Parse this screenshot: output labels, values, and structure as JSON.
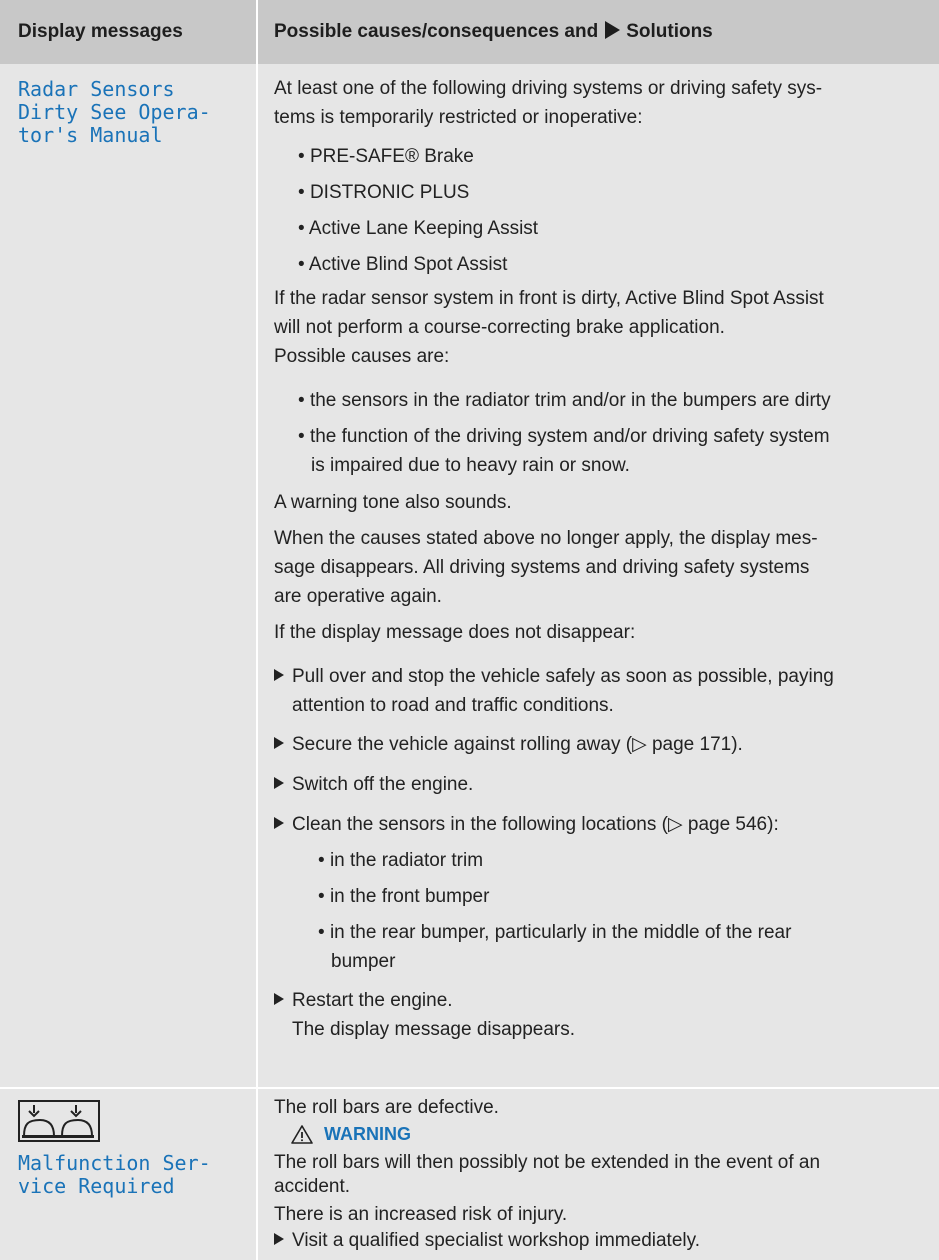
{
  "header": {
    "col1": "Display messages",
    "col2_a": "Possible causes/consequences and",
    "col2_b": "Solutions"
  },
  "row1": {
    "message_lines": [
      "Radar Sensors",
      "Dirty See Opera-",
      "tor's Manual"
    ],
    "intro_lines": [
      "At least one of the following driving systems or driving safety sys-",
      "tems is temporarily restricted or inoperative:"
    ],
    "systems": [
      "PRE-SAFE® Brake",
      "DISTRONIC PLUS",
      "Active Lane Keeping Assist",
      "Active Blind Spot Assist"
    ],
    "dirty_lines": [
      "If the radar sensor system in front is dirty, Active Blind Spot Assist",
      "will not perform a course-correcting brake application."
    ],
    "causes_intro": "Possible causes are:",
    "causes": [
      [
        "the sensors in the radiator trim and/or in the bumpers are dirty"
      ],
      [
        "the function of the driving system and/or driving safety system",
        "is impaired due to heavy rain or snow."
      ]
    ],
    "tone": "A warning tone also sounds.",
    "apply_lines": [
      "When the causes stated above no longer apply, the display mes-",
      "sage disappears. All driving systems and driving safety systems",
      "are operative again."
    ],
    "not_disappear": "If the display message does not disappear:",
    "step1": [
      "Pull over and stop the vehicle safely as soon as possible, paying",
      "attention to road and traffic conditions."
    ],
    "step2": "Secure the vehicle against rolling away (▷ page 171).",
    "step3": "Switch off the engine.",
    "step4": "Clean the sensors in the following locations (▷ page 546):",
    "locations": [
      [
        "in the radiator trim"
      ],
      [
        "in the front bumper"
      ],
      [
        "in the rear bumper, particularly in the middle of the rear",
        "bumper"
      ]
    ],
    "step5": "Restart the engine.",
    "step5_result": "The display message disappears."
  },
  "row2": {
    "icon": "roll-bar-icon",
    "message_lines": [
      "Malfunction Ser-",
      "vice Required"
    ],
    "defect": "The roll bars are defective.",
    "warning_title": "WARNING",
    "warning_lines": [
      "The roll bars will then possibly not be extended in the event of an",
      "accident."
    ],
    "risk": "There is an increased risk of injury.",
    "visit": "Visit a qualified specialist workshop immediately."
  },
  "colors": {
    "header_bg": "#c8c8c8",
    "row_bg": "#e6e6e6",
    "accent": "#1a73b8"
  }
}
